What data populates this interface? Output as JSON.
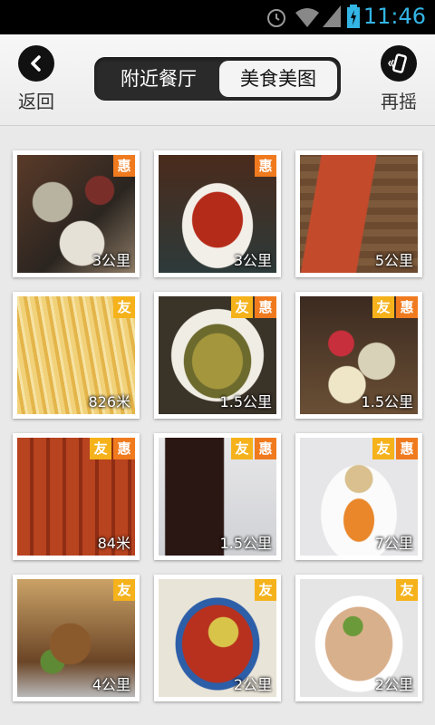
{
  "status": {
    "time": "11:46"
  },
  "header": {
    "back_label": "返回",
    "shake_label": "再摇",
    "tabs": [
      "附近餐厅",
      "美食美图"
    ],
    "active_tab": 1
  },
  "badges": {
    "hui": "惠",
    "you": "友"
  },
  "items": [
    {
      "distance": "3公里",
      "you": false,
      "hui": true
    },
    {
      "distance": "3公里",
      "you": false,
      "hui": true
    },
    {
      "distance": "5公里",
      "you": false,
      "hui": false
    },
    {
      "distance": "826米",
      "you": true,
      "hui": false
    },
    {
      "distance": "1.5公里",
      "you": true,
      "hui": true
    },
    {
      "distance": "1.5公里",
      "you": true,
      "hui": true
    },
    {
      "distance": "84米",
      "you": true,
      "hui": true
    },
    {
      "distance": "1.5公里",
      "you": true,
      "hui": true
    },
    {
      "distance": "7公里",
      "you": true,
      "hui": true
    },
    {
      "distance": "4公里",
      "you": true,
      "hui": false
    },
    {
      "distance": "2公里",
      "you": true,
      "hui": false
    },
    {
      "distance": "2公里",
      "you": true,
      "hui": false
    }
  ],
  "colors": {
    "accent_time": "#33b5e5",
    "badge_hui": "#f07a1e",
    "badge_you": "#f5b21b"
  }
}
